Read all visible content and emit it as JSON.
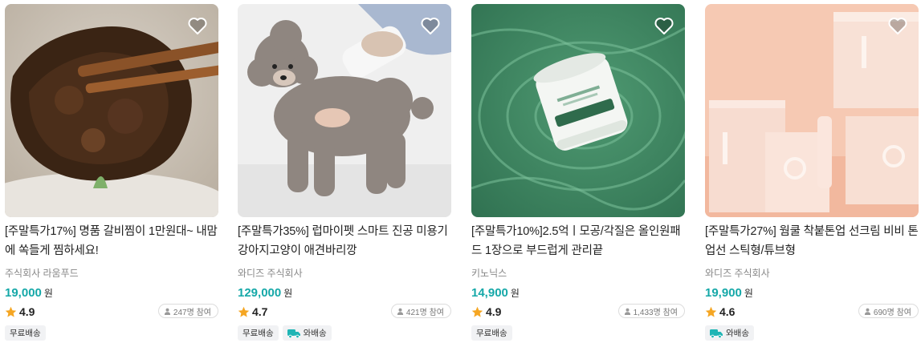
{
  "products": [
    {
      "title": "[주말특가17%] 명품 갈비찜이 1만원대~ 내맘에 쏙들게 찜하세요!",
      "seller": "주식회사 라움푸드",
      "price": "19,000",
      "currency": "원",
      "rating": "4.9",
      "participants": "247명 참여",
      "tags": [
        "무료배송"
      ],
      "image_icon": "braised-ribs-image"
    },
    {
      "title": "[주말특가35%] 럽마이펫 스마트 진공 미용기 강아지고양이 애견바리깡",
      "seller": "와디즈 주식회사",
      "price": "129,000",
      "currency": "원",
      "rating": "4.7",
      "participants": "421명 참여",
      "tags": [
        "무료배송",
        "와배송"
      ],
      "image_icon": "poodle-grooming-image"
    },
    {
      "title": "[주말특가10%]2.5억ㅣ모공/각질은 올인원패드 1장으로 부드럽게 관리끝",
      "seller": "키노닉스",
      "price": "14,900",
      "currency": "원",
      "rating": "4.9",
      "participants": "1,433명 참여",
      "tags": [
        "무료배송"
      ],
      "image_icon": "pad-jar-in-water-image"
    },
    {
      "title": "[주말특가27%] 웜쿨 착붙톤업 선크림 비비 톤업선 스틱형/튜브형",
      "seller": "와디즈 주식회사",
      "price": "19,900",
      "currency": "원",
      "rating": "4.6",
      "participants": "690명 참여",
      "tags": [
        "와배송"
      ],
      "image_icon": "pink-sunscreen-boxes-image"
    }
  ],
  "colors": {
    "price": "#15a8a8",
    "star": "#f5a623",
    "wabaesong_badge": "#1fb5b5"
  }
}
